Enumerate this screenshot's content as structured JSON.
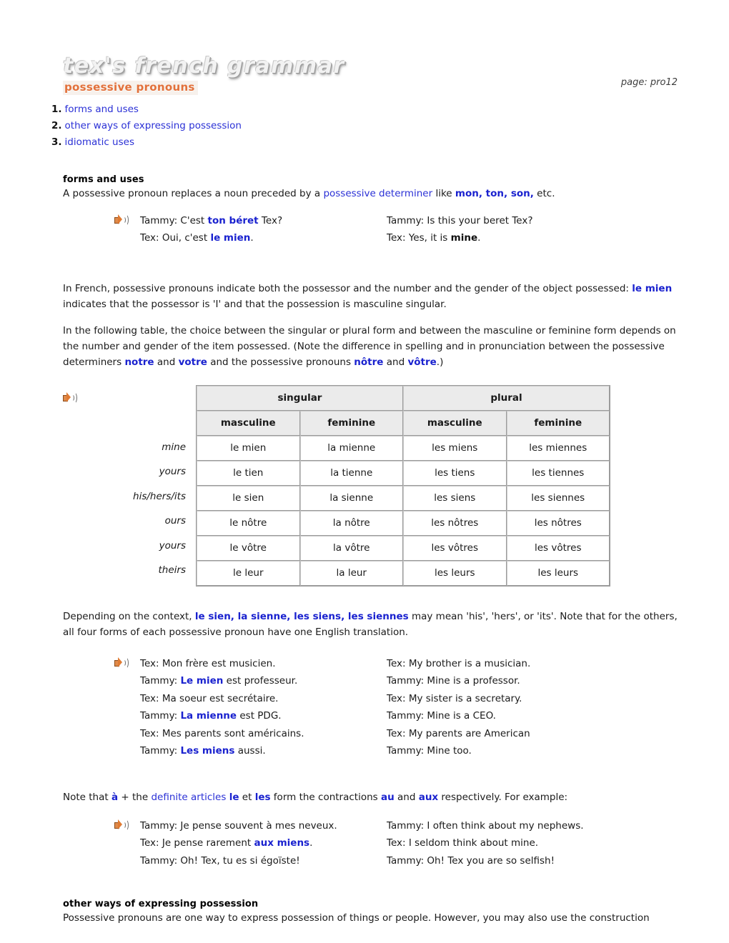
{
  "header": {
    "logo_title": "tex's french grammar",
    "logo_subtitle": "possessive pronouns",
    "page_ref": "page: pro12",
    "speaker_icon": "speaker-icon"
  },
  "nav": {
    "items": [
      {
        "num": "1.",
        "label": "forms and uses"
      },
      {
        "num": "2.",
        "label": "other ways of expressing possession"
      },
      {
        "num": "3.",
        "label": "idiomatic uses"
      }
    ]
  },
  "sections": {
    "forms_and_uses": {
      "heading": "forms and uses",
      "intro_a": "A possessive pronoun replaces a noun preceded by a ",
      "intro_link": "possessive determiner",
      "intro_b": " like ",
      "intro_bold": "mon, ton, son,",
      "intro_c": " etc."
    },
    "other_ways": {
      "heading": "other ways of expressing possession",
      "text": "Possessive pronouns are one way to express possession of things or people. However, you may also use the construction"
    }
  },
  "dialogue_1": {
    "lines": [
      {
        "fr_a": "Tammy: C'est ",
        "fr_bold": "ton béret",
        "fr_b": " Tex?",
        "en_a": "Tammy: Is this your beret Tex?",
        "en_bold": "",
        "en_b": ""
      },
      {
        "fr_a": "Tex: Oui, c'est ",
        "fr_bold": "le mien",
        "fr_b": ".",
        "en_a": "Tex: Yes, it is ",
        "en_bold": "mine",
        "en_b": "."
      }
    ]
  },
  "paragraph_1": {
    "a": "In French, possessive pronouns indicate both the possessor and the number and the gender of the object possessed: ",
    "bold": "le mien",
    "b": " indicates that the possessor is 'I' and that the possession is masculine singular."
  },
  "paragraph_2": {
    "a": "In the following table, the choice between the singular or plural form and between the masculine or feminine form depends on the number and gender of the item possessed. (Note the difference in spelling and in pronunciation between the possessive determiners ",
    "b1": "notre",
    "b": " and ",
    "b2": "votre",
    "c": " and the possessive pronouns ",
    "b3": "nôtre",
    "d": " and ",
    "b4": "vôtre",
    "e": ".)"
  },
  "table": {
    "group_headers": [
      "singular",
      "plural"
    ],
    "sub_headers": [
      "masculine",
      "feminine",
      "masculine",
      "feminine"
    ],
    "row_labels": [
      "mine",
      "yours",
      "his/hers/its",
      "ours",
      "yours",
      "theirs"
    ],
    "rows": [
      [
        "le mien",
        "la mienne",
        "les miens",
        "les miennes"
      ],
      [
        "le tien",
        "la tienne",
        "les tiens",
        "les tiennes"
      ],
      [
        "le sien",
        "la sienne",
        "les siens",
        "les siennes"
      ],
      [
        "le nôtre",
        "la nôtre",
        "les nôtres",
        "les nôtres"
      ],
      [
        "le vôtre",
        "la vôtre",
        "les vôtres",
        "les vôtres"
      ],
      [
        "le leur",
        "la leur",
        "les leurs",
        "les leurs"
      ]
    ]
  },
  "paragraph_3": {
    "a": "Depending on the context, ",
    "bold": "le sien, la sienne, les siens, les siennes",
    "b": " may mean 'his', 'hers', or 'its'. Note that for the others, all four forms of each possessive pronoun have one English translation."
  },
  "dialogue_2": {
    "lines": [
      {
        "fr_a": "Tex: Mon frère est musicien.",
        "fr_bold": "",
        "fr_b": "",
        "en_a": "Tex: My brother is a musician.",
        "en_bold": "",
        "en_b": ""
      },
      {
        "fr_a": "Tammy: ",
        "fr_bold": "Le mien",
        "fr_b": " est professeur.",
        "en_a": "Tammy: Mine is a professor.",
        "en_bold": "",
        "en_b": ""
      },
      {
        "fr_a": "Tex: Ma soeur est secrétaire.",
        "fr_bold": "",
        "fr_b": "",
        "en_a": "Tex: My sister is a secretary.",
        "en_bold": "",
        "en_b": ""
      },
      {
        "fr_a": "Tammy: ",
        "fr_bold": "La mienne",
        "fr_b": " est PDG.",
        "en_a": "Tammy: Mine is a CEO.",
        "en_bold": "",
        "en_b": ""
      },
      {
        "fr_a": "Tex: Mes parents sont américains.",
        "fr_bold": "",
        "fr_b": "",
        "en_a": "Tex: My parents are American",
        "en_bold": "",
        "en_b": ""
      },
      {
        "fr_a": "Tammy: ",
        "fr_bold": "Les miens",
        "fr_b": " aussi.",
        "en_a": "Tammy: Mine too.",
        "en_bold": "",
        "en_b": ""
      }
    ]
  },
  "paragraph_4": {
    "a": "Note that ",
    "b1": "à",
    "b": " + the ",
    "link": "definite articles",
    "c": " ",
    "b2": "le",
    "d": " et ",
    "b3": "les",
    "e": " form the contractions ",
    "b4": "au",
    "f": " and ",
    "b5": "aux",
    "g": " respectively. For example:"
  },
  "dialogue_3": {
    "lines": [
      {
        "fr_a": "Tammy: Je pense souvent à mes neveux.",
        "fr_bold": "",
        "fr_b": "",
        "en_a": "Tammy: I often think about my nephews.",
        "en_bold": "",
        "en_b": ""
      },
      {
        "fr_a": "Tex: Je pense rarement ",
        "fr_bold": "aux miens",
        "fr_b": ".",
        "en_a": "Tex: I seldom think about mine.",
        "en_bold": "",
        "en_b": ""
      },
      {
        "fr_a": "Tammy: Oh! Tex, tu es si égoïste!",
        "fr_bold": "",
        "fr_b": "",
        "en_a": "Tammy: Oh! Tex you are so selfish!",
        "en_bold": "",
        "en_b": ""
      }
    ]
  },
  "colors": {
    "link_blue": "#2b31d6",
    "bold_blue": "#1a22cf",
    "accent_orange": "#e2703a",
    "table_header_bg": "#ebebeb",
    "table_border": "#9b9b9b"
  }
}
